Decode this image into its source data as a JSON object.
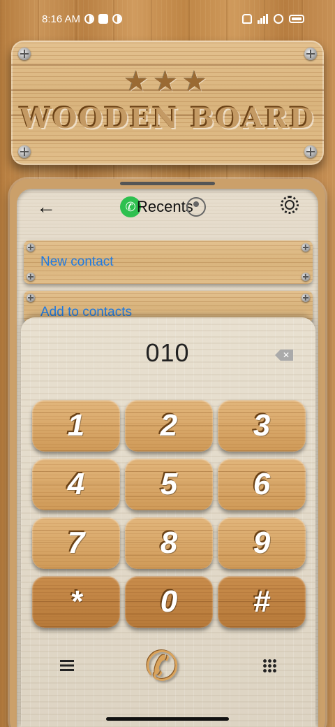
{
  "status_bar": {
    "time": "8:16 AM"
  },
  "sign": {
    "stars": "★★★",
    "title": "WOODEN BOARD"
  },
  "toolbar": {
    "back_icon": "←",
    "call_icon": "✆",
    "tab_label": "Recents"
  },
  "options": [
    {
      "label": "New contact"
    },
    {
      "label": "Add to contacts"
    }
  ],
  "dialer": {
    "number": "010",
    "backspace_icon": "✕",
    "keys": [
      "1",
      "2",
      "3",
      "4",
      "5",
      "6",
      "7",
      "8",
      "9",
      "*",
      "0",
      "#"
    ]
  },
  "bottom": {
    "call_icon": "✆"
  },
  "colors": {
    "link": "#1f7ae0",
    "call_badge": "#2ec04f"
  }
}
